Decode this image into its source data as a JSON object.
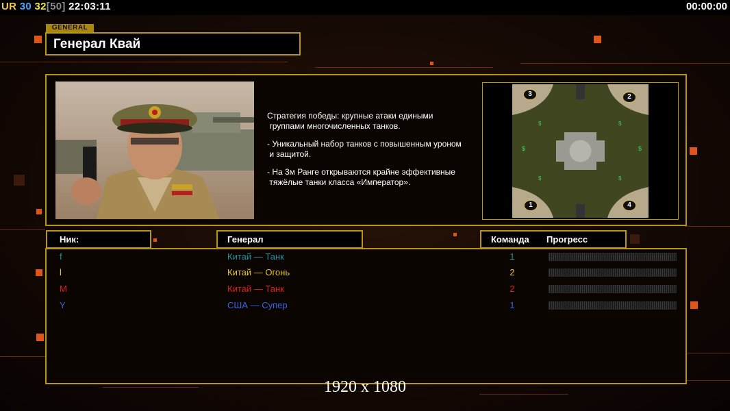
{
  "hud": {
    "ur_label": "UR",
    "num1": "30",
    "num2": "32",
    "num3": "[50]",
    "clock": "22:03:11",
    "timer": "00:00:00"
  },
  "general": {
    "tag": "GENERAL",
    "name": "Генерал Квай",
    "description": [
      "Стратегия победы: крупные атаки едиными\n группами многочисленных танков.",
      "- Уникальный набор танков с повышенным уроном\n и защитой.",
      "- На 3м Ранге открываются крайне эффективные\n тяжёлые танки класса «Император»."
    ]
  },
  "map": {
    "spawns": [
      "3",
      "2",
      "1",
      "4"
    ]
  },
  "table": {
    "headers": {
      "nick": "Ник:",
      "general": "Генерал",
      "team": "Команда",
      "progress": "Прогресс"
    },
    "rows": [
      {
        "nick": "f",
        "general": "Китай — Танк",
        "team": "1",
        "color": "#1e8fa0",
        "progress": 0
      },
      {
        "nick": "l",
        "general": "Китай — Огонь",
        "team": "2",
        "color": "#e6c81e",
        "progress": 0
      },
      {
        "nick": "M",
        "general": "Китай — Танк",
        "team": "2",
        "color": "#e01e1e",
        "progress": 0
      },
      {
        "nick": "Y",
        "general": "США — Супер",
        "team": "1",
        "color": "#3a64e6",
        "progress": 0
      }
    ]
  },
  "resolution": "1920 x 1080",
  "colors": {
    "frame": "#b8960f",
    "accent": "#e0561a"
  }
}
